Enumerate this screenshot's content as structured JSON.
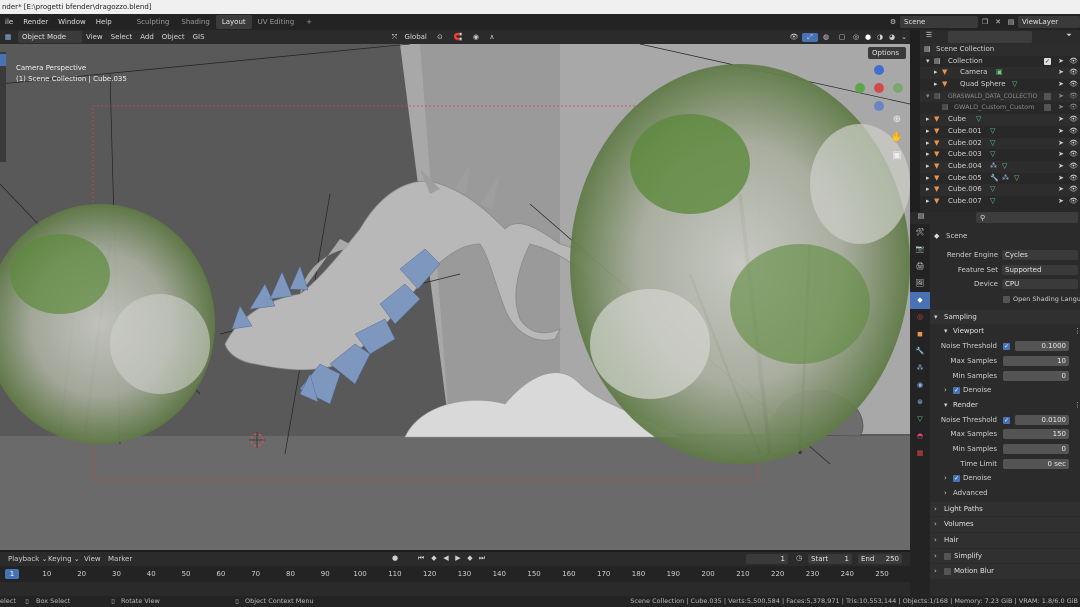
{
  "window": {
    "title": "nder* [E:\\progetti bfender\\dragozzo.blend]"
  },
  "topbar": {
    "menus": [
      "ile",
      "Render",
      "Window",
      "Help"
    ],
    "workspaces": [
      "Sculpting",
      "Shading",
      "Layout",
      "UV Editing"
    ],
    "add_ws": "+",
    "scene": "Scene",
    "view_layer": "ViewLayer"
  },
  "viewport_header": {
    "mode": "Object Mode",
    "menus": [
      "View",
      "Select",
      "Add",
      "Object",
      "GIS"
    ],
    "transform": "Global",
    "options": "Options"
  },
  "viewport": {
    "overlay_line1": "Camera Perspective",
    "overlay_line2": "(1) Scene Collection | Cube.035"
  },
  "outliner": {
    "search_placeholder": "",
    "rows": [
      {
        "name": "Scene Collection"
      },
      {
        "name": "Collection"
      },
      {
        "name": "Camera"
      },
      {
        "name": "Quad Sphere"
      },
      {
        "name": "GRASWALD_DATA_COLLECTIO"
      },
      {
        "name": "GWALD_Custom_Custom"
      },
      {
        "name": "Cube"
      },
      {
        "name": "Cube.001"
      },
      {
        "name": "Cube.002"
      },
      {
        "name": "Cube.003"
      },
      {
        "name": "Cube.004"
      },
      {
        "name": "Cube.005"
      },
      {
        "name": "Cube.006"
      },
      {
        "name": "Cube.007"
      }
    ]
  },
  "properties": {
    "context": "Scene",
    "render_engine_label": "Render Engine",
    "render_engine": "Cycles",
    "feature_set_label": "Feature Set",
    "feature_set": "Supported",
    "device_label": "Device",
    "device": "CPU",
    "open_shading": "Open Shading Language",
    "sampling": "Sampling",
    "viewport": "Viewport",
    "vp_noise_label": "Noise Threshold",
    "vp_noise": "0.1000",
    "vp_max_label": "Max Samples",
    "vp_max": "10",
    "vp_min_label": "Min Samples",
    "vp_min": "0",
    "denoise": "Denoise",
    "render": "Render",
    "r_noise_label": "Noise Threshold",
    "r_noise": "0.0100",
    "r_max_label": "Max Samples",
    "r_max": "150",
    "r_min_label": "Min Samples",
    "r_min": "0",
    "time_limit_label": "Time Limit",
    "time_limit": "0 sec",
    "denoise2": "Denoise",
    "advanced": "Advanced",
    "light_paths": "Light Paths",
    "volumes": "Volumes",
    "hair": "Hair",
    "simplify": "Simplify",
    "motion_blur": "Motion Blur"
  },
  "timeline": {
    "menus": [
      "Playback",
      "Keying",
      "View",
      "Marker"
    ],
    "current_frame": "1",
    "start_label": "Start",
    "start": "1",
    "end_label": "End",
    "end": "250",
    "playhead": "1",
    "ticks": [
      "10",
      "20",
      "30",
      "40",
      "50",
      "60",
      "70",
      "80",
      "90",
      "100",
      "110",
      "120",
      "130",
      "140",
      "150",
      "160",
      "170",
      "180",
      "190",
      "200",
      "210",
      "220",
      "230",
      "240",
      "250"
    ]
  },
  "statusbar": {
    "select": "elect",
    "box_select": "Box Select",
    "rotate": "Rotate View",
    "context_menu": "Object Context Menu",
    "stats": "Scene Collection | Cube.035 | Verts:5,500,584 | Faces:5,378,971 | Tris:10,553,144 | Objects:1/168 | Memory: 7.23 GiB | VRAM: 1.8/6.0 GiB"
  },
  "colors": {
    "accent": "#4772b3",
    "object_orange": "#e8944a",
    "mesh_green": "#6fd08a"
  }
}
